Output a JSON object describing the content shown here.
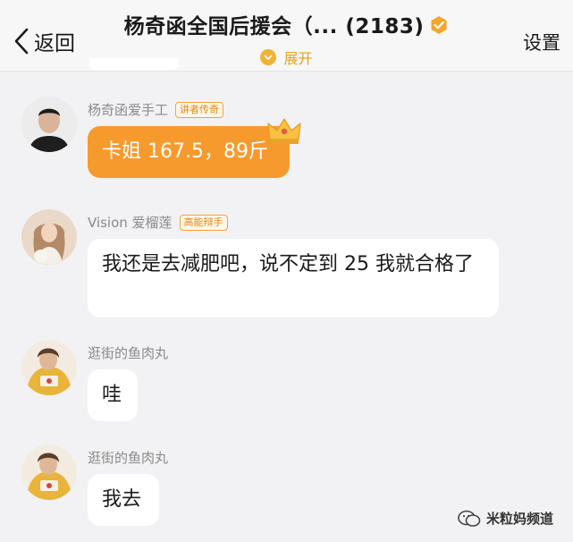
{
  "header": {
    "back_label": "返回",
    "title": "杨奇函全国后援会（... (2183)",
    "expand_label": "展开",
    "settings_label": "设置"
  },
  "messages": [
    {
      "sender": "杨奇函爱手工",
      "badge": "讲者传奇",
      "text": "卡姐 167.5，89斤",
      "style": "highlight"
    },
    {
      "sender": "Vision 爱榴莲",
      "badge": "高能辩手",
      "text": "我还是去减肥吧，说不定到 25 我就合格了"
    },
    {
      "sender": "逛街的鱼肉丸",
      "text": "哇"
    },
    {
      "sender": "逛街的鱼肉丸",
      "text": "我去"
    }
  ],
  "watermark": "米粒妈频道",
  "colors": {
    "accent": "#f79a2d",
    "badge_text": "#e08a16",
    "background": "#f2f2f4"
  }
}
